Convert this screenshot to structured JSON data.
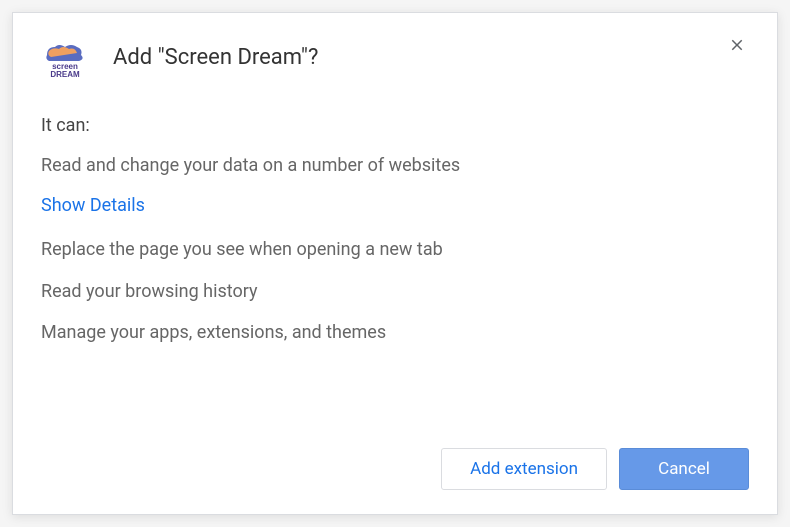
{
  "dialog": {
    "title": "Add \"Screen Dream\"?",
    "intro": "It can:",
    "permissions": [
      "Read and change your data on a number of websites",
      "Replace the page you see when opening a new tab",
      "Read your browsing history",
      "Manage your apps, extensions, and themes"
    ],
    "show_details": "Show Details",
    "actions": {
      "add": "Add extension",
      "cancel": "Cancel"
    },
    "extension_name": "Screen Dream",
    "icon_text_top": "screen",
    "icon_text_bottom": "DREAM"
  }
}
